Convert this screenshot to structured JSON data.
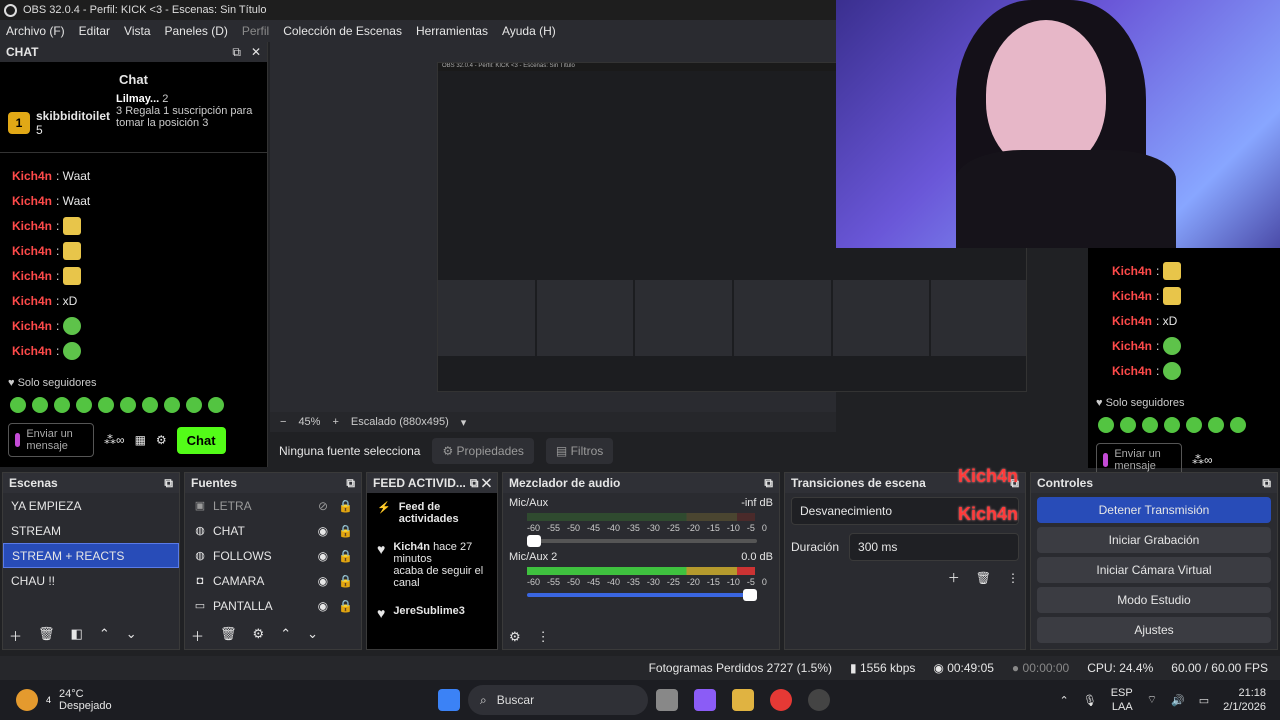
{
  "title": "OBS 32.0.4 - Perfil: KICK <3 - Escenas: Sin Título",
  "menu": [
    "Archivo (F)",
    "Editar",
    "Vista",
    "Paneles (D)",
    "Perfil",
    "Colección de Escenas",
    "Herramientas",
    "Ayuda (H)"
  ],
  "chat": {
    "dock_title": "CHAT",
    "panel_title": "Chat",
    "leader1_rank": "1",
    "leader1_name": "skibbiditoilet",
    "leader1_count": "5",
    "leader2_name": "Lilmay...",
    "leader2_count": "2",
    "leader2_rank": "3",
    "promo": "Regala 1 suscripción para tomar la posición 3",
    "messages": [
      {
        "user": "Kich4n",
        "text": ": Waat"
      },
      {
        "user": "Kich4n",
        "text": ": Waat"
      },
      {
        "user": "Kich4n",
        "text": ":"
      },
      {
        "user": "Kich4n",
        "text": ":"
      },
      {
        "user": "Kich4n",
        "text": ":"
      },
      {
        "user": "Kich4n",
        "text": ": xD"
      },
      {
        "user": "Kich4n",
        "text": ":"
      },
      {
        "user": "Kich4n",
        "text": ":"
      }
    ],
    "followers_only": "Solo seguidores",
    "input_placeholder": "Enviar un mensaje",
    "send_label": "Chat"
  },
  "right_chat": {
    "messages": [
      {
        "user": "Kich4n",
        "text": ":"
      },
      {
        "user": "Kich4n",
        "text": ":"
      },
      {
        "user": "Kich4n",
        "text": ": xD"
      },
      {
        "user": "Kich4n",
        "text": ":"
      },
      {
        "user": "Kich4n",
        "text": ":"
      }
    ],
    "followers_only": "Solo seguidores",
    "input_placeholder": "Enviar un mensaje"
  },
  "preview": {
    "zoom": "45%",
    "scaling": "Escalado (880x495)",
    "no_source": "Ninguna fuente selecciona",
    "properties": "Propiedades",
    "filters": "Filtros"
  },
  "scenes": {
    "title": "Escenas",
    "items": [
      "YA EMPIEZA",
      "STREAM",
      "STREAM + REACTS",
      "CHAU !!"
    ],
    "selected": "STREAM + REACTS"
  },
  "sources": {
    "title": "Fuentes",
    "items": [
      {
        "name": "LETRA",
        "icon": "image-icon"
      },
      {
        "name": "CHAT",
        "icon": "globe-icon"
      },
      {
        "name": "FOLLOWS",
        "icon": "globe-icon"
      },
      {
        "name": "CAMARA",
        "icon": "camera-icon"
      },
      {
        "name": "PANTALLA",
        "icon": "monitor-icon"
      }
    ]
  },
  "feed": {
    "title": "FEED ACTIVID...",
    "header": "Feed de actividades",
    "entries": [
      {
        "user": "Kich4n",
        "time": "hace 27 minutos",
        "text": "acaba de seguir el canal"
      },
      {
        "user": "JereSublime3",
        "time": "",
        "text": ""
      }
    ]
  },
  "mixer": {
    "title": "Mezclador de audio",
    "channels": [
      {
        "name": "Mic/Aux",
        "db": "-inf dB",
        "level": 0
      },
      {
        "name": "Mic/Aux 2",
        "db": "0.0 dB",
        "level": 1
      }
    ],
    "scale": [
      "-60",
      "-55",
      "-50",
      "-45",
      "-40",
      "-35",
      "-30",
      "-25",
      "-20",
      "-15",
      "-10",
      "-5",
      "0"
    ]
  },
  "transitions": {
    "title": "Transiciones de escena",
    "type": "Desvanecimiento",
    "duration_label": "Duración",
    "duration": "300 ms"
  },
  "controls": {
    "title": "Controles",
    "overlay_user": "Kich4n",
    "buttons": [
      "Detener Transmisión",
      "Iniciar Grabación",
      "Iniciar Cámara Virtual",
      "Modo Estudio",
      "Ajustes"
    ]
  },
  "status": {
    "dropped": "Fotogramas Perdidos 2727 (1.5%)",
    "bitrate": "1556 kbps",
    "stream_time": "00:49:05",
    "rec_time": "00:00:00",
    "cpu": "CPU: 24.4%",
    "fps": "60.00 / 60.00 FPS"
  },
  "taskbar": {
    "temp": "24°C",
    "weather": "Despejado",
    "search": "Buscar",
    "lang": "ESP",
    "lang2": "LAA",
    "time": "21:18",
    "date": "2/1/2026",
    "notif": "4"
  },
  "colors": {
    "accent": "#284cb8",
    "kick": "#53fc18",
    "chat_user": "#ff4a4a"
  }
}
